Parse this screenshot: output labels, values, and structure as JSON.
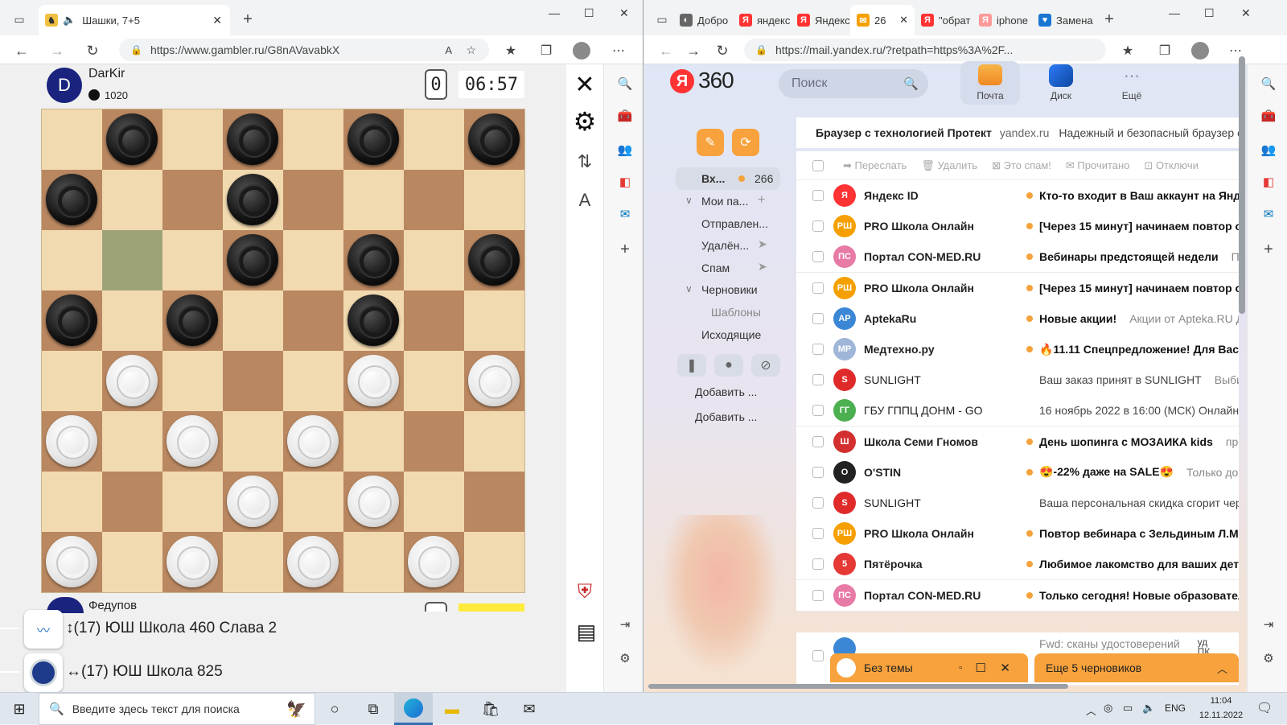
{
  "left": {
    "tab": {
      "title": "Шашки, 7+5"
    },
    "url": "https://www.gambler.ru/G8nAVavabkX",
    "game": {
      "top_player": {
        "initial": "D",
        "name": "DarKir",
        "rating": "1020",
        "move_counter": "0",
        "clock": "06:57"
      },
      "bottom_player": {
        "name": "Федупов"
      },
      "board": [
        "_b_b_b_b",
        "b__b____",
        "___b_b_b",
        "b_b__b__",
        "_w___w_w",
        "w_w_w___",
        "___w_w__",
        "w_w_w_w_"
      ],
      "highlighted_square": "2,1",
      "side_icons": [
        "close-icon",
        "gear-icon",
        "flip-icon",
        "font-icon"
      ],
      "teams": [
        {
          "arrow": "↕",
          "text": "(17) ЮШ Школа 460 Слава 2"
        },
        {
          "arrow": "↔",
          "text": "(17) ЮШ Школа 825"
        }
      ]
    }
  },
  "right": {
    "tabs": [
      "Добро",
      "яндекс",
      "Яндекс",
      "26",
      "\"обрат",
      "iphone",
      "Замена"
    ],
    "url": "https://mail.yandex.ru/?retpath=https%3A%2F...",
    "header": {
      "logo_ya": "Я",
      "logo_360": "360",
      "search_placeholder": "Поиск",
      "apps": [
        "Почта",
        "Диск",
        "Ещё"
      ]
    },
    "promo": {
      "title": "Браузер с технологией Протект",
      "domain": "yandex.ru",
      "text": "Надежный и безопасный браузер с з"
    },
    "folders": {
      "inbox": "Вх...",
      "inbox_count": "266",
      "my_folders": "Мои па...",
      "sent": "Отправлен...",
      "deleted": "Удалён...",
      "spam": "Спам",
      "drafts": "Черновики",
      "templates": "Шаблоны",
      "outgoing": "Исходящие",
      "add1": "Добавить ...",
      "add2": "Добавить ..."
    },
    "toolbar": [
      "Переслать",
      "Удалить",
      "Это спам!",
      "Прочитано",
      "Отключи"
    ],
    "emails": [
      {
        "av": "Я",
        "avc": "#f33",
        "sender": "Яндекс ID",
        "dot": true,
        "subject": "Кто-то входит в Ваш аккаунт на Яндекс",
        "preview": "",
        "bold": true
      },
      {
        "av": "РШ",
        "avc": "#f5a000",
        "sender": "PRO Школа Онлайн",
        "dot": true,
        "subject": "[Через 15 минут] начинаем повтор онл",
        "preview": "",
        "bold": true
      },
      {
        "av": "ПС",
        "avc": "#e87aa6",
        "sender": "Портал CON-MED.RU",
        "dot": true,
        "subject": "Вебинары предстоящей недели",
        "preview": "Под",
        "bold": true
      },
      {
        "av": "РШ",
        "avc": "#f5a000",
        "sender": "PRO Школа Онлайн",
        "dot": true,
        "subject": "[Через 15 минут] начинаем повтор онл",
        "preview": "",
        "bold": true
      },
      {
        "av": "AP",
        "avc": "#3b87d6",
        "sender": "AptekaRu",
        "dot": true,
        "subject": "Новые акции!",
        "preview": "Акции от Apteka.RU До",
        "bold": true
      },
      {
        "av": "МР",
        "avc": "#9fb6d8",
        "sender": "Медтехно.ру",
        "dot": true,
        "subject": "🔥11.11 Спецпредложение! Для Вас СК",
        "preview": "",
        "bold": true
      },
      {
        "av": "S",
        "avc": "#e02a2a",
        "sender": "SUNLIGHT",
        "dot": false,
        "subject": "Ваш заказ принят в SUNLIGHT",
        "preview": "Выбира",
        "bold": false
      },
      {
        "av": "ГГ",
        "avc": "#4caf50",
        "sender": "ГБУ ГППЦ ДОНМ - GO",
        "dot": false,
        "subject": "16 ноябрь 2022 в 16:00 (МСК) Онлайн-ко",
        "preview": "",
        "bold": false
      },
      {
        "av": "Ш",
        "avc": "#d32f2f",
        "sender": "Школа Семи Гномов",
        "dot": true,
        "subject": "День шопинга с МОЗАИКА kids",
        "preview": "проме",
        "bold": true
      },
      {
        "av": "O",
        "avc": "#222",
        "sender": "O'STIN",
        "dot": true,
        "subject": "😍-22% даже на SALE😍",
        "preview": "Только до 13",
        "bold": true
      },
      {
        "av": "S",
        "avc": "#e02a2a",
        "sender": "SUNLIGHT",
        "dot": false,
        "subject": "Ваша персональная скидка сгорит через",
        "preview": "",
        "bold": false
      },
      {
        "av": "РШ",
        "avc": "#f5a000",
        "sender": "PRO Школа Онлайн",
        "dot": true,
        "subject": "Повтор вебинара с Зельдиным Л.М. и",
        "preview": "",
        "bold": true
      },
      {
        "av": "5",
        "avc": "#e53935",
        "sender": "Пятёрочка",
        "dot": true,
        "subject": "Любимое лакомство для ваших детей!",
        "preview": "",
        "bold": true
      },
      {
        "av": "ПС",
        "avc": "#e87aa6",
        "sender": "Портал CON-MED.RU",
        "dot": true,
        "subject": "Только сегодня! Новые образовательн",
        "preview": "",
        "bold": true
      }
    ],
    "partial_row": {
      "subject": "Fwd: сканы удостоверений",
      "preview": "уд ПК"
    },
    "compose_bar": {
      "draft": "Без темы",
      "more": "Еще 5 черновиков"
    }
  },
  "taskbar": {
    "search_placeholder": "Введите здесь текст для поиска",
    "lang": "ENG",
    "time": "11:04",
    "date": "12.11.2022"
  }
}
